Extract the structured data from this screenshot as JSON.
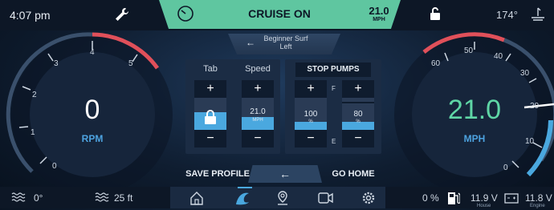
{
  "top_bar": {
    "time": "4:07 pm",
    "cruise_label": "CRUISE ON",
    "speed_value": "21.0",
    "speed_unit": "MPH",
    "heading": "174°"
  },
  "rpm_gauge": {
    "value": "0",
    "unit": "RPM",
    "ticks": [
      "0",
      "1",
      "2",
      "3",
      "4",
      "5"
    ]
  },
  "speed_gauge": {
    "value": "21.0",
    "unit": "MPH",
    "ticks": [
      "0",
      "10",
      "20",
      "30",
      "40",
      "50",
      "60"
    ]
  },
  "profile": {
    "name_line1": "Beginner Surf",
    "name_line2": "Left"
  },
  "tab_control": {
    "header": "Tab",
    "plus": "+",
    "minus": "−"
  },
  "speed_control": {
    "header": "Speed",
    "plus": "+",
    "minus": "−",
    "value": "21.0",
    "unit": "MPH"
  },
  "pumps": {
    "stop_label": "STOP PUMPS",
    "left": {
      "plus": "+",
      "minus": "−",
      "value": "100",
      "unit": "%",
      "level_pct": 100
    },
    "right": {
      "plus": "+",
      "minus": "−",
      "value": "80",
      "unit": "%",
      "level_pct": 80
    },
    "full_label": "F",
    "empty_label": "E"
  },
  "bottom_actions": {
    "save_profile": "SAVE PROFILE",
    "back_arrow": "←",
    "go_home": "GO HOME"
  },
  "bottom_bar": {
    "water_temp": "0°",
    "depth": "25 ft",
    "fuel": "0 %",
    "house_voltage": "11.9 V",
    "house_label": "House",
    "engine_voltage": "11.8 V",
    "engine_label": "Engine"
  },
  "colors": {
    "accent_green": "#5fc6a0",
    "accent_blue": "#4aa8df",
    "redline": "#e0505a"
  }
}
